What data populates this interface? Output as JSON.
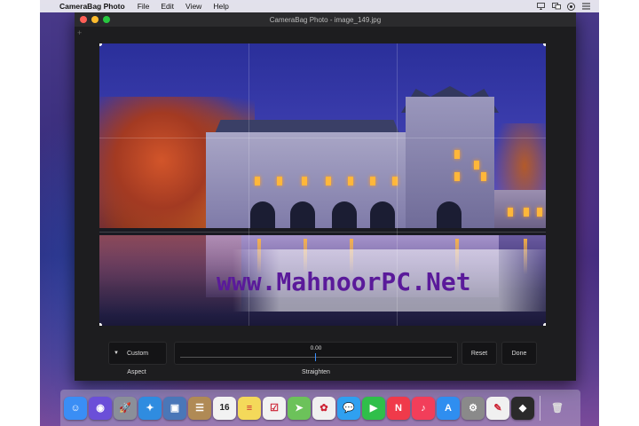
{
  "menubar": {
    "app_name": "CameraBag Photo",
    "menus": [
      "File",
      "Edit",
      "View",
      "Help"
    ],
    "status_icons": [
      "airplay-icon",
      "display-icon",
      "siri-icon",
      "list-icon"
    ]
  },
  "window": {
    "title": "CameraBag Photo - image_149.jpg",
    "plus_label": "+"
  },
  "canvas": {
    "watermark": "www.MahnoorPC.Net"
  },
  "controls": {
    "aspect_value": "Custom",
    "aspect_label": "Aspect",
    "straighten_value": "0.00",
    "straighten_label": "Straighten",
    "reset_label": "Reset",
    "done_label": "Done"
  },
  "dock": {
    "apps": [
      {
        "name": "finder-icon",
        "color": "#3a8ef5",
        "glyph": "☺"
      },
      {
        "name": "siri-icon",
        "color": "#6b4fd8",
        "glyph": "◉"
      },
      {
        "name": "launchpad-icon",
        "color": "#8a8f99",
        "glyph": "🚀"
      },
      {
        "name": "safari-icon",
        "color": "#2f8ce0",
        "glyph": "✦"
      },
      {
        "name": "photo-preview-icon",
        "color": "#4a77b8",
        "glyph": "▣"
      },
      {
        "name": "contacts-icon",
        "color": "#b08a55",
        "glyph": "☰"
      },
      {
        "name": "calendar-icon",
        "color": "#f2f2f2",
        "glyph": "16"
      },
      {
        "name": "notes-icon",
        "color": "#f4d95a",
        "glyph": "≡"
      },
      {
        "name": "reminders-icon",
        "color": "#f2f2f2",
        "glyph": "☑"
      },
      {
        "name": "maps-icon",
        "color": "#6cc25a",
        "glyph": "➤"
      },
      {
        "name": "photos-icon",
        "color": "#f0f0f0",
        "glyph": "✿"
      },
      {
        "name": "messages-icon",
        "color": "#2fa0f0",
        "glyph": "💬"
      },
      {
        "name": "facetime-icon",
        "color": "#2fbf4a",
        "glyph": "▶"
      },
      {
        "name": "news-icon",
        "color": "#f03a4a",
        "glyph": "N"
      },
      {
        "name": "music-icon",
        "color": "#f23e5a",
        "glyph": "♪"
      },
      {
        "name": "app-store-icon",
        "color": "#2f8ef0",
        "glyph": "A"
      },
      {
        "name": "system-preferences-icon",
        "color": "#8a8a8a",
        "glyph": "⚙"
      },
      {
        "name": "textedit-icon",
        "color": "#f0f0f0",
        "glyph": "✎"
      },
      {
        "name": "camerabag-icon",
        "color": "#2a2a2a",
        "glyph": "◆"
      }
    ],
    "trash": {
      "name": "trash-icon",
      "glyph": "🗑"
    },
    "calendar_day": "16"
  }
}
